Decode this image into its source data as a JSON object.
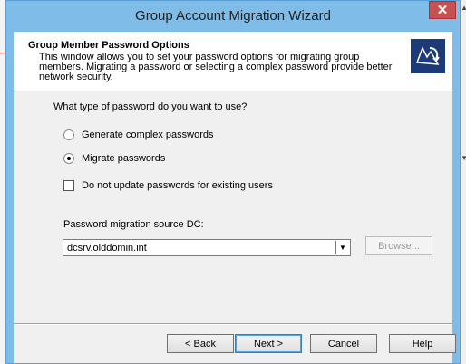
{
  "window": {
    "title": "Group Account Migration Wizard",
    "close_label": "✕"
  },
  "header": {
    "title": "Group Member Password Options",
    "description": "This window allows you to set your password options for migrating group members. Migrating a password or selecting a complex password provide better network security."
  },
  "question": "What type of password do you want to use?",
  "options": {
    "generate_label": "Generate complex passwords",
    "migrate_label": "Migrate passwords",
    "selected": "Migrate passwords"
  },
  "no_update_checkbox": {
    "label": "Do not update passwords for existing users",
    "checked": false
  },
  "source_dc": {
    "label": "Password migration source DC:",
    "value": "dcsrv.olddomin.int",
    "browse_label": "Browse..."
  },
  "buttons": {
    "back": "< Back",
    "next": "Next >",
    "cancel": "Cancel",
    "help": "Help"
  },
  "colors": {
    "window_border": "#7fbde8",
    "close": "#c75050",
    "logo_bg": "#1d3a78"
  }
}
